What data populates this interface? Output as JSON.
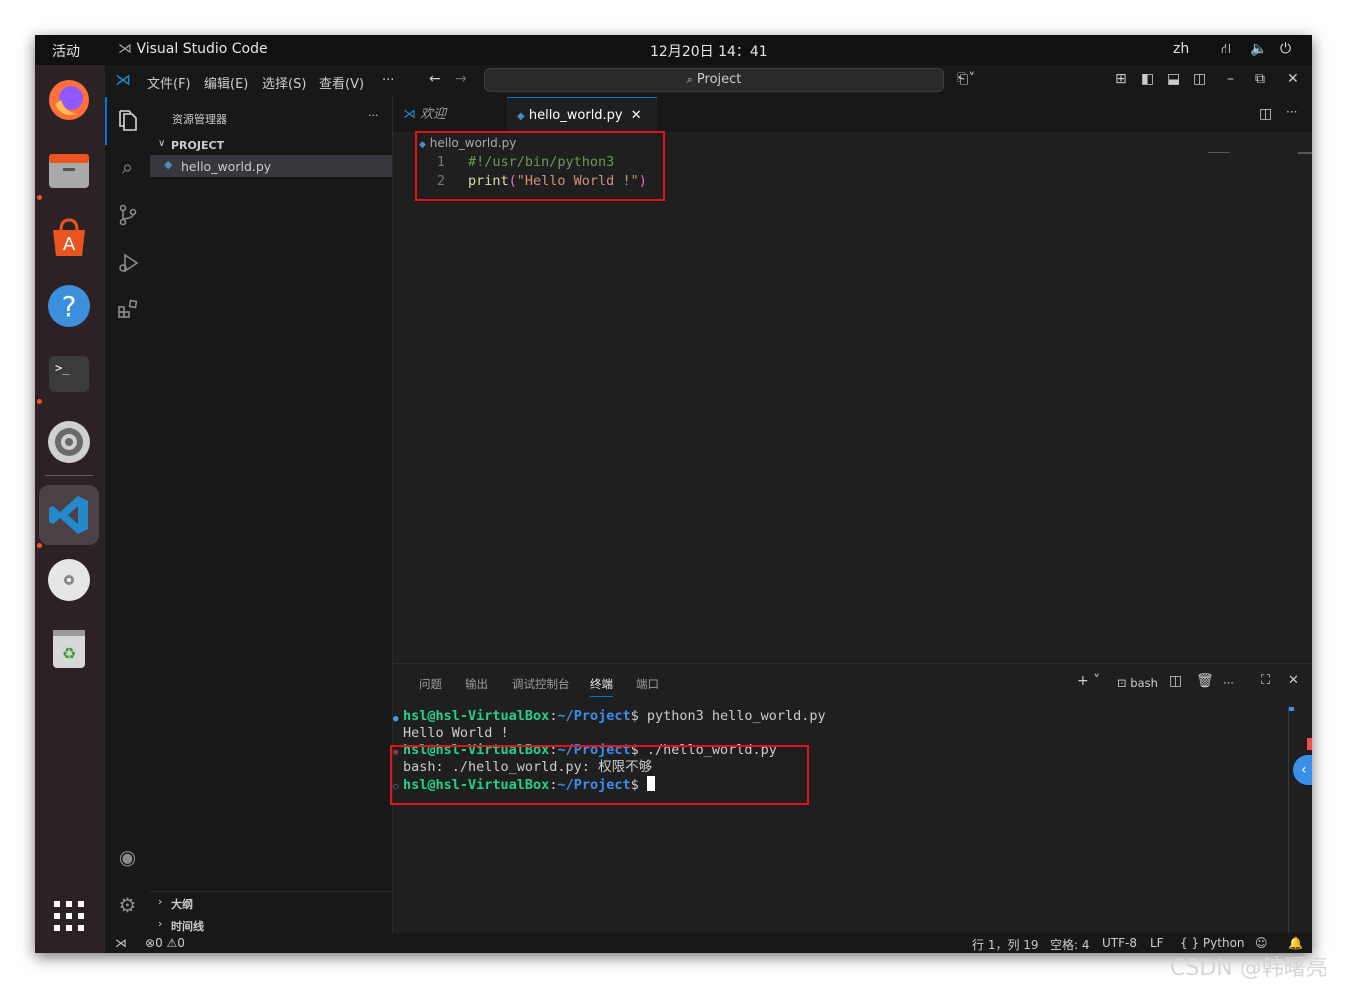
{
  "topbar": {
    "activities": "活动",
    "app_name": "Visual Studio Code",
    "clock": "12月20日  14：41",
    "lang": "zh"
  },
  "vscode": {
    "menus": [
      "文件(F)",
      "编辑(E)",
      "选择(S)",
      "查看(V)",
      "···"
    ],
    "command_center": "Project",
    "explorer": {
      "title": "资源管理器",
      "more": "···",
      "folder": "PROJECT",
      "files": [
        "hello_world.py"
      ],
      "outline": "大纲",
      "timeline": "时间线"
    },
    "tabs": [
      {
        "label": "欢迎",
        "active": false
      },
      {
        "label": "hello_world.py",
        "active": true
      }
    ],
    "breadcrumb": "hello_world.py",
    "code_lines": [
      {
        "num": "1",
        "text": "#!/usr/bin/python3"
      },
      {
        "num": "2",
        "text_fn": "print",
        "text_paren_open": "(",
        "text_str": "\"Hello World !\"",
        "text_paren_close": ")"
      }
    ],
    "panel_tabs": [
      "问题",
      "输出",
      "调试控制台",
      "终端",
      "端口"
    ],
    "active_panel_tab": "终端",
    "terminal_shell": "bash",
    "terminal_lines": [
      {
        "user": "hsl@hsl-VirtualBox",
        "path": "~/Project",
        "cmd": "python3 hello_world.py"
      },
      {
        "output": "Hello World !"
      },
      {
        "user": "hsl@hsl-VirtualBox",
        "path": "~/Project",
        "cmd": "./hello_world.py"
      },
      {
        "output": "bash: ./hello_world.py: 权限不够"
      },
      {
        "user": "hsl@hsl-VirtualBox",
        "path": "~/Project",
        "cmd": ""
      }
    ],
    "status": {
      "errors": "0",
      "warnings": "0",
      "position": "行 1，列 19",
      "spaces": "空格: 4",
      "encoding": "UTF-8",
      "eol": "LF",
      "language": "Python",
      "language_icon": "{ }"
    }
  },
  "watermark": "CSDN @韩曙亮",
  "colors": {
    "highlight_box": "#e0141e",
    "terminal_green": "#23d18b",
    "terminal_blue": "#3b8eea",
    "ubuntu_orange": "#e95420",
    "vscode_blue": "#0078d4"
  }
}
